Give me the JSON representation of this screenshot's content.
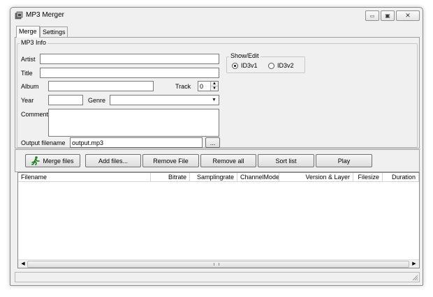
{
  "window": {
    "title": "MP3 Merger",
    "controls": {
      "minimize": "▭",
      "maximize": "▣",
      "close": "✕"
    }
  },
  "tabs": [
    {
      "label": "Merge",
      "active": true
    },
    {
      "label": "Settings",
      "active": false
    }
  ],
  "mp3_info": {
    "legend": "MP3 Info",
    "artist_label": "Artist",
    "artist_value": "",
    "title_label": "Title",
    "title_value": "",
    "album_label": "Album",
    "album_value": "",
    "track_label": "Track",
    "track_value": "0",
    "year_label": "Year",
    "year_value": "",
    "genre_label": "Genre",
    "genre_value": "",
    "comment_label": "Comment",
    "comment_value": "",
    "output_label": "Output filename",
    "output_value": "output.mp3",
    "browse_label": "..."
  },
  "show_edit": {
    "legend": "Show/Edit",
    "options": [
      {
        "label": "ID3v1",
        "checked": true
      },
      {
        "label": "ID3v2",
        "checked": false
      }
    ]
  },
  "toolbar": {
    "merge_files": "Merge files",
    "add_files": "Add files...",
    "remove_file": "Remove File",
    "remove_all": "Remove all",
    "sort_list": "Sort list",
    "play": "Play"
  },
  "file_list": {
    "columns": [
      "Filename",
      "Bitrate",
      "Samplingrate",
      "ChannelMode",
      "Version & Layer",
      "Filesize",
      "Duration"
    ],
    "rows": []
  },
  "statusbar": {
    "text": ""
  },
  "icons": {
    "app": "music-file-icon",
    "merge": "running-man-icon",
    "combo": "chevron-down-icon",
    "scroll_left": "arrow-left-icon",
    "scroll_right": "arrow-right-icon",
    "grip": "resize-grip-icon"
  },
  "colors": {
    "window_bg": "#f0f0f0",
    "merge_icon": "#1a7a1a"
  }
}
